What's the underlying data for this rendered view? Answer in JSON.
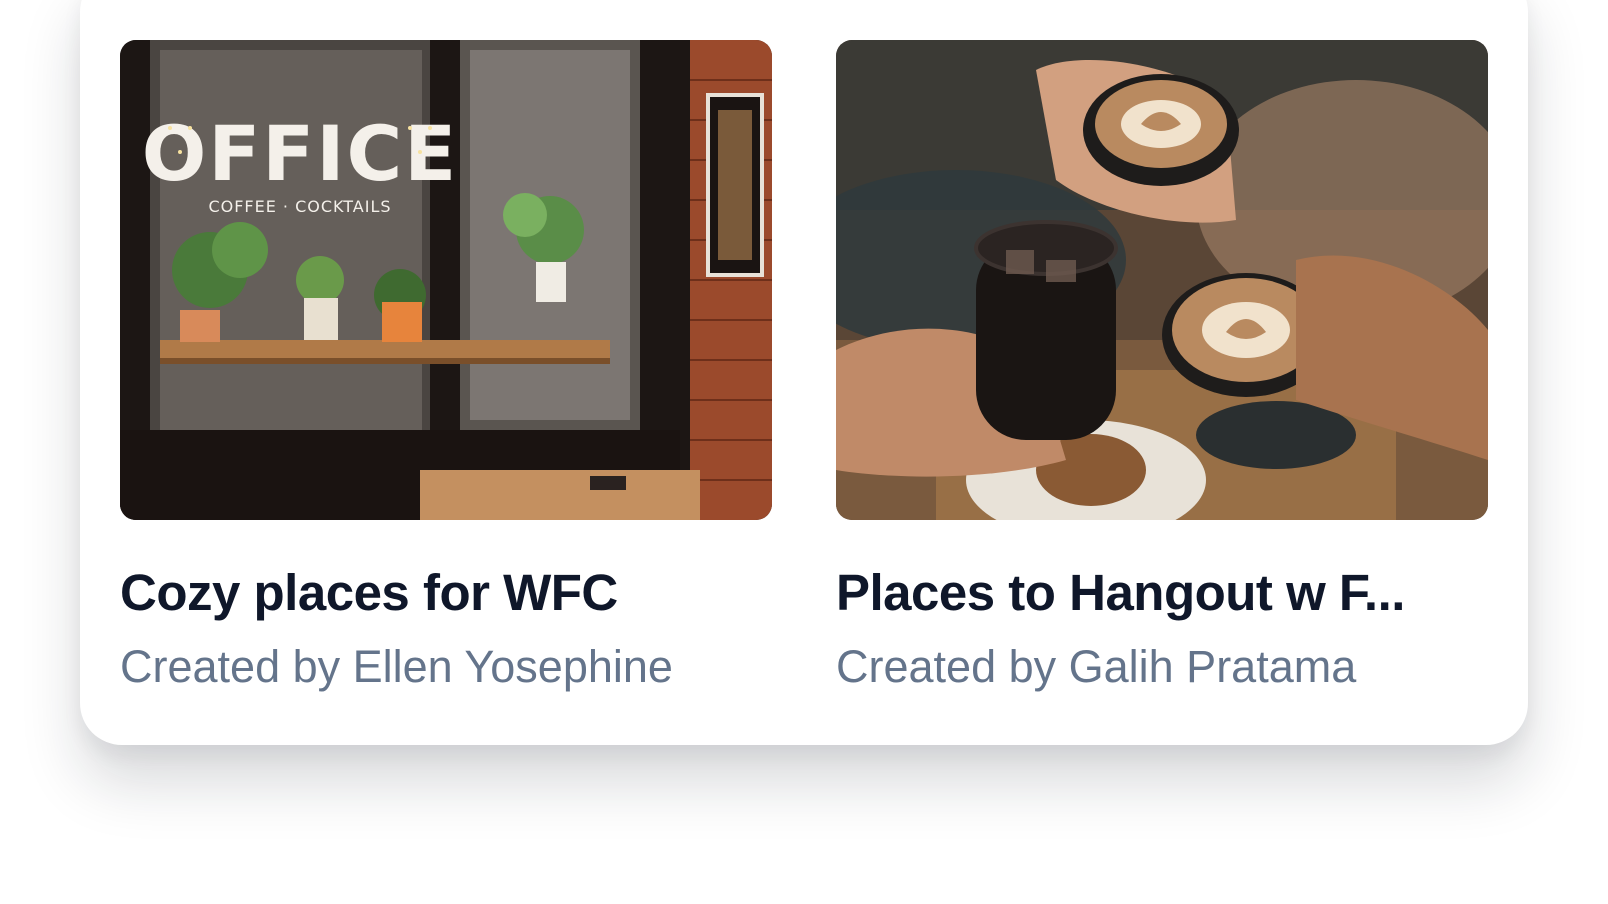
{
  "collections": [
    {
      "title": "Cozy places for WFC",
      "creator": "Created by Ellen Yosephine",
      "image": "coffee-shop-storefront-photo",
      "sign_text": "OFFICE",
      "sign_subtext": "COFFEE · COCKTAILS"
    },
    {
      "title": "Places to Hangout w F...",
      "creator": "Created by Galih Pratama",
      "image": "friends-toasting-coffee-photo"
    }
  ],
  "colors": {
    "title": "#0f172a",
    "subtitle": "#64748b",
    "card_background": "#ffffff"
  }
}
